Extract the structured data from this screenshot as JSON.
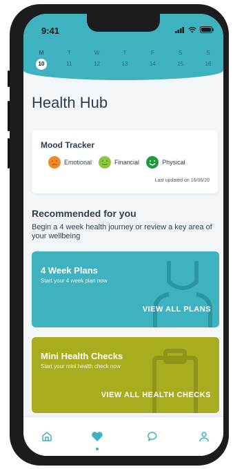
{
  "status_bar": {
    "time": "9:41"
  },
  "calendar": {
    "days": [
      {
        "letter": "M",
        "date": "10",
        "active": true
      },
      {
        "letter": "T",
        "date": "11"
      },
      {
        "letter": "W",
        "date": "12"
      },
      {
        "letter": "T",
        "date": "13"
      },
      {
        "letter": "F",
        "date": "14"
      },
      {
        "letter": "S",
        "date": "15"
      },
      {
        "letter": "S",
        "date": "16"
      }
    ]
  },
  "page": {
    "title": "Health Hub"
  },
  "mood_tracker": {
    "title": "Mood Tracker",
    "items": [
      {
        "label": "Emotional",
        "icon": "sad-face-icon",
        "color": "#f08a24"
      },
      {
        "label": "Financial",
        "icon": "neutral-face-icon",
        "color": "#8cc63f"
      },
      {
        "label": "Physical",
        "icon": "happy-face-icon",
        "color": "#1f9a3a"
      }
    ],
    "updated": "Last updated on 16/06/20"
  },
  "recommended": {
    "title": "Recommended for you",
    "subtitle": "Begin a 4 week health journey or review a key area of your wellbeing"
  },
  "plans_card": {
    "title": "4 Week Plans",
    "subtitle": "Start your 4 week plan now",
    "action": "VIEW ALL PLANS",
    "color": "#3fb2bf"
  },
  "checks_card": {
    "title": "Mini Health Checks",
    "subtitle": "Start your mini health check now",
    "action": "VIEW ALL HEALTH CHECKS",
    "color": "#a7ad1f"
  },
  "bottom_nav": {
    "items": [
      "home-icon",
      "heart-icon",
      "chat-icon",
      "profile-icon"
    ],
    "active": "heart-icon"
  }
}
